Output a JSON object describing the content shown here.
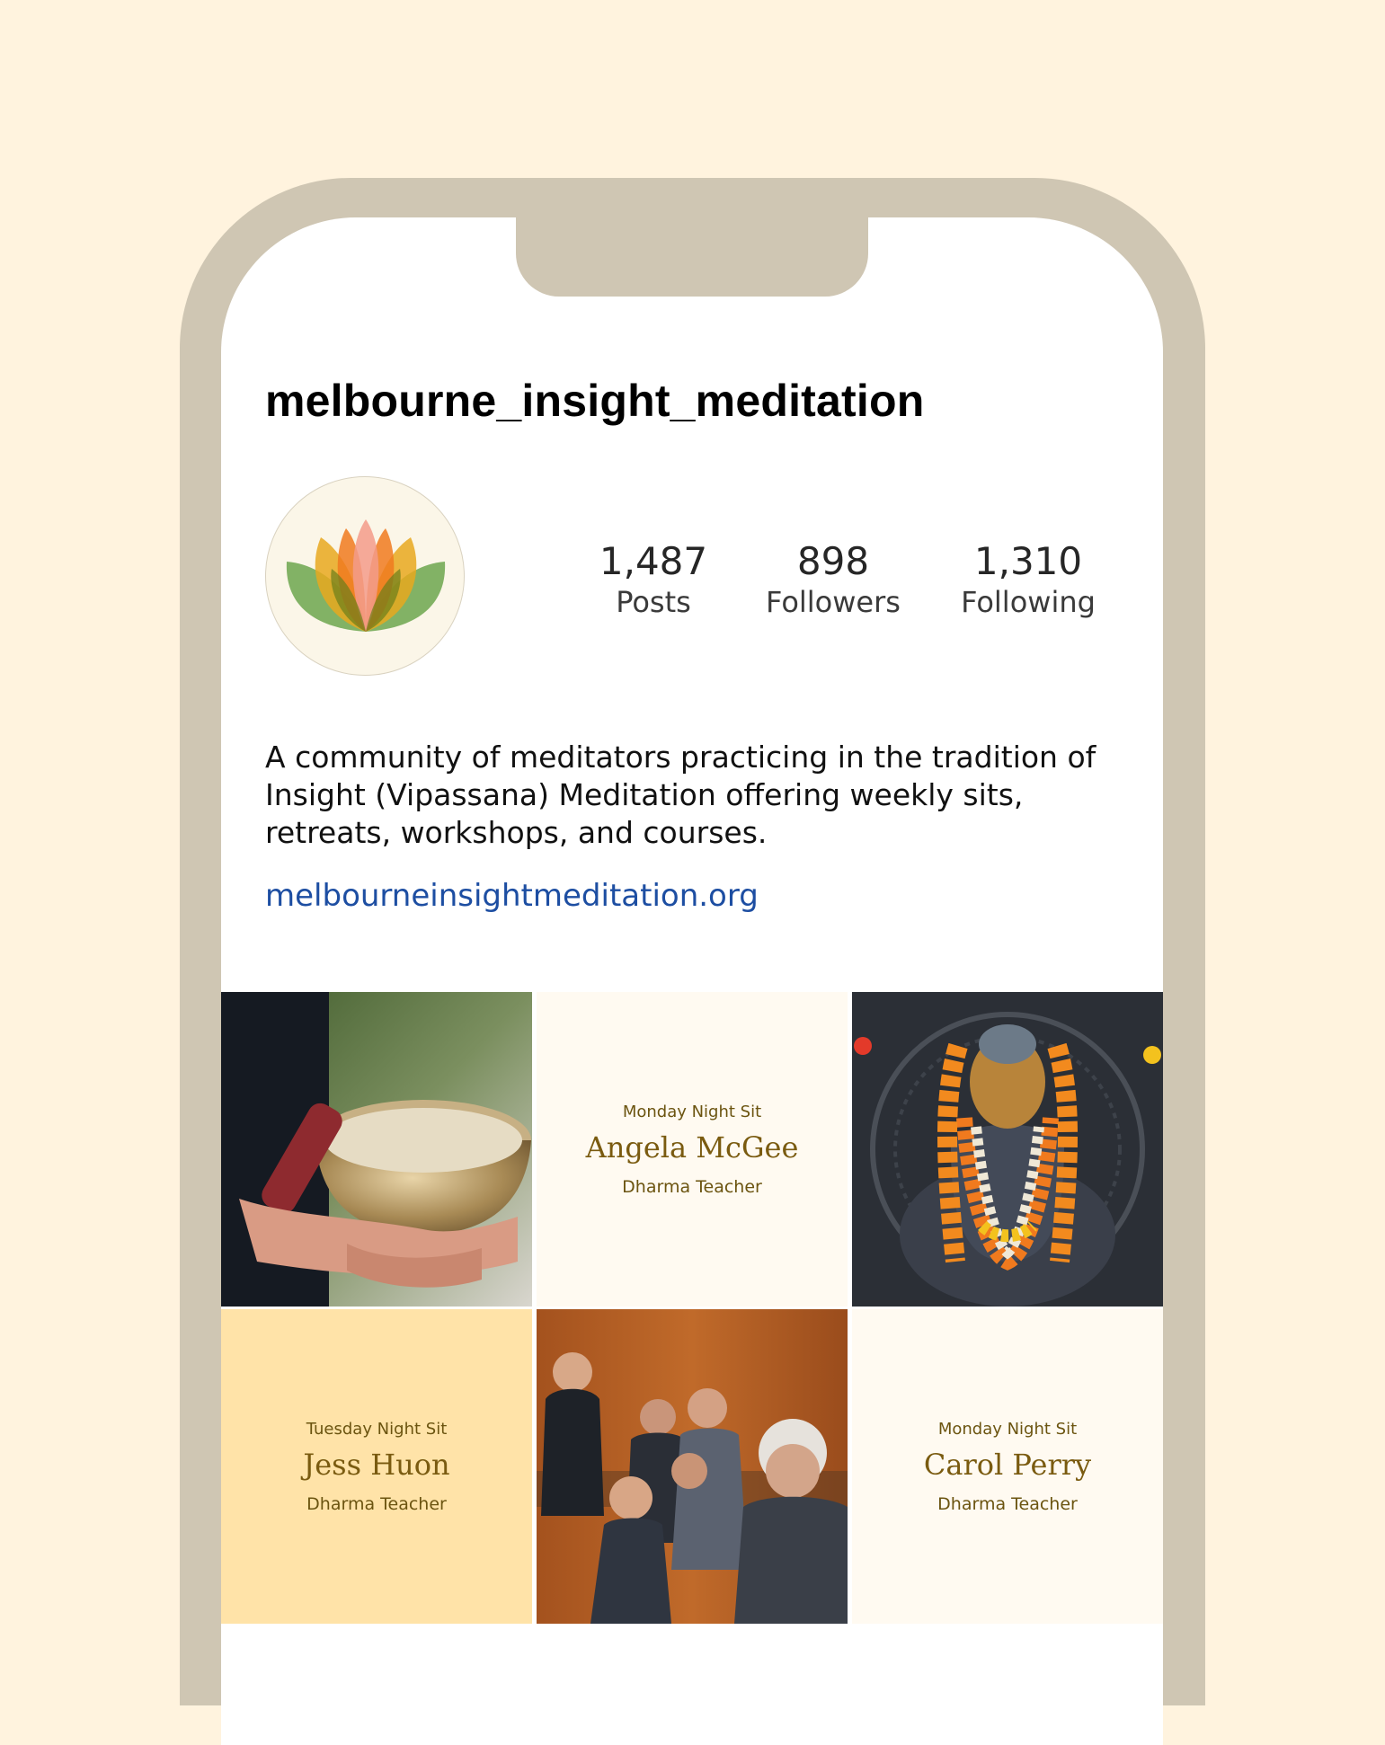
{
  "profile": {
    "username": "melbourne_insight_meditation",
    "avatar_icon": "lotus-logo-icon",
    "bio": "A community of meditators practicing in the tradition of Insight (Vipassana) Meditation offering weekly sits, retreats, workshops, and courses.",
    "website": "melbourneinsightmeditation.org"
  },
  "stats": {
    "posts": {
      "value": "1,487",
      "label": "Posts"
    },
    "followers": {
      "value": "898",
      "label": "Followers"
    },
    "following": {
      "value": "1,310",
      "label": "Following"
    }
  },
  "posts": {
    "p2": {
      "event": "Monday Night Sit",
      "name": "Angela McGee",
      "role": "Dharma Teacher",
      "bg": "#fffaf1"
    },
    "p4": {
      "event": "Tuesday Night Sit",
      "name": "Jess Huon",
      "role": "Dharma Teacher",
      "bg": "#ffe3a8"
    },
    "p6": {
      "event": "Monday Night Sit",
      "name": "Carol Perry",
      "role": "Dharma Teacher",
      "bg": "#fffaf1"
    }
  },
  "colors": {
    "page_bg": "#fff3de",
    "phone_frame": "#cfc6b3",
    "link": "#1d4ea2",
    "card_text": "#7a5b10"
  }
}
